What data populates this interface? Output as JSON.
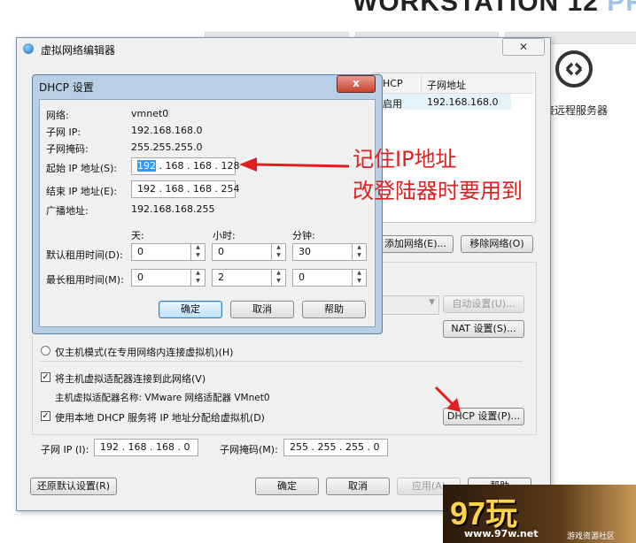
{
  "brand": {
    "text": "WORKSTATION 12",
    "pro": " PRO"
  },
  "remote": {
    "label": "接远程服务器"
  },
  "window": {
    "title": "虚拟网络编辑器",
    "table": {
      "headers": [
        "HCP",
        "子网地址"
      ],
      "row": [
        "启用",
        "192.168.168.0"
      ]
    },
    "add_network_label": "添加网络(E)...",
    "remove_network_label": "移除网络(O)",
    "auto_settings_label": "自动设置(U)...",
    "nat_settings_label": "NAT 设置(S)...",
    "host_only_label": "仅主机模式(在专用网络内连接虚拟机)(H)",
    "connect_adapter_label": "将主机虚拟适配器连接到此网络(V)",
    "adapter_name_label": "主机虚拟适配器名称: VMware 网络适配器 VMnet0",
    "use_dhcp_label": "使用本地 DHCP 服务将 IP 地址分配给虚拟机(D)",
    "dhcp_settings_label": "DHCP 设置(P)...",
    "subnet_ip_label": "子网 IP (I):",
    "subnet_ip_value": "192 . 168 . 168 .  0",
    "subnet_mask_label": "子网掩码(M):",
    "subnet_mask_value": "255 . 255 . 255 .  0",
    "restore_label": "还原默认设置(R)",
    "ok_label": "确定",
    "cancel_label": "取消",
    "apply_label": "应用(A)",
    "help_label": "帮助"
  },
  "dhcp": {
    "title": "DHCP 设置",
    "close_label": "x",
    "network_label": "网络:",
    "network_value": "vmnet0",
    "subnet_ip_label": "子网 IP:",
    "subnet_ip_value": "192.168.168.0",
    "subnet_mask_label": "子网掩码:",
    "subnet_mask_value": "255.255.255.0",
    "start_ip_label": "起始 IP 地址(S):",
    "start_ip_first": "192",
    "start_ip_rest": " . 168 . 168 . 128",
    "end_ip_label": "结束 IP 地址(E):",
    "end_ip_value": "192 . 168 . 168 . 254",
    "broadcast_label": "广播地址:",
    "broadcast_value": "192.168.168.255",
    "col_days": "天:",
    "col_hours": "小时:",
    "col_minutes": "分钟:",
    "default_lease_label": "默认租用时间(D):",
    "default_lease": [
      "0",
      "0",
      "30"
    ],
    "max_lease_label": "最长租用时间(M):",
    "max_lease": [
      "0",
      "2",
      "0"
    ],
    "ok_label": "确定",
    "cancel_label": "取消",
    "help_label": "帮助"
  },
  "annotation": {
    "line1": "记住IP地址",
    "line2": "改登陆器时要用到",
    "color": "#e02020"
  },
  "watermark": {
    "logo": "97玩",
    "url": "www.97w.net",
    "sub": "游戏资源社区"
  }
}
